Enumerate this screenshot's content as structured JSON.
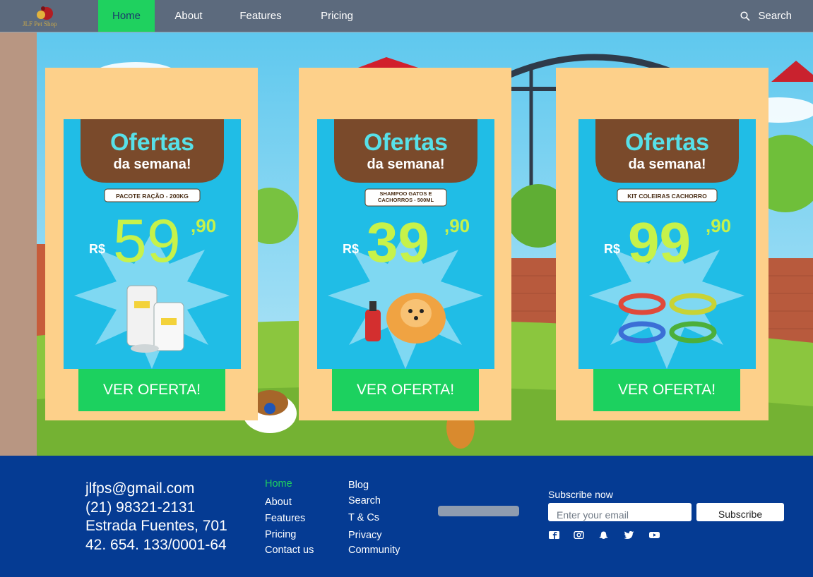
{
  "nav": {
    "logo_text": "JLF Pet Shop",
    "items": [
      {
        "label": "Home",
        "active": true
      },
      {
        "label": "About",
        "active": false
      },
      {
        "label": "Features",
        "active": false
      },
      {
        "label": "Pricing",
        "active": false
      }
    ],
    "search_label": "Search"
  },
  "offers": [
    {
      "banner_title": "Ofertas",
      "banner_subtitle": "da semana!",
      "product": "PACOTE RAÇÃO - 200KG",
      "currency": "R$",
      "price_int": "59",
      "price_cents": ",90",
      "button": "VER OFERTA!"
    },
    {
      "banner_title": "Ofertas",
      "banner_subtitle": "da semana!",
      "product": "SHAMPOO GATOS E CACHORROS - 500ML",
      "currency": "R$",
      "price_int": "39",
      "price_cents": ",90",
      "button": "VER OFERTA!"
    },
    {
      "banner_title": "Ofertas",
      "banner_subtitle": "da semana!",
      "product": "KIT COLEIRAS CACHORRO",
      "currency": "R$",
      "price_int": "99",
      "price_cents": ",90",
      "button": "VER OFERTA!"
    }
  ],
  "footer": {
    "contact": {
      "email": "jlfps@gmail.com",
      "phone": "(21) 98321-2131",
      "address": "Estrada Fuentes, 701",
      "cnpj": "42. 654. 133/0001-64"
    },
    "links_col1": [
      "Home",
      "About",
      "Features",
      "Pricing",
      "Contact us"
    ],
    "links_col2": [
      "Blog",
      "Search",
      "T & Cs",
      "Privacy",
      "Community"
    ],
    "subscribe": {
      "title": "Subscribe now",
      "placeholder": "Enter your email",
      "button": "Subscribe"
    },
    "social_icons": [
      "facebook-icon",
      "instagram-icon",
      "snapchat-icon",
      "twitter-icon",
      "youtube-icon"
    ]
  },
  "colors": {
    "nav_bg": "#5c6a7d",
    "accent_green": "#1fd15f",
    "card_bg": "#fdd08a",
    "offer_blue": "#20bde6",
    "footer_bg": "#053b93"
  }
}
